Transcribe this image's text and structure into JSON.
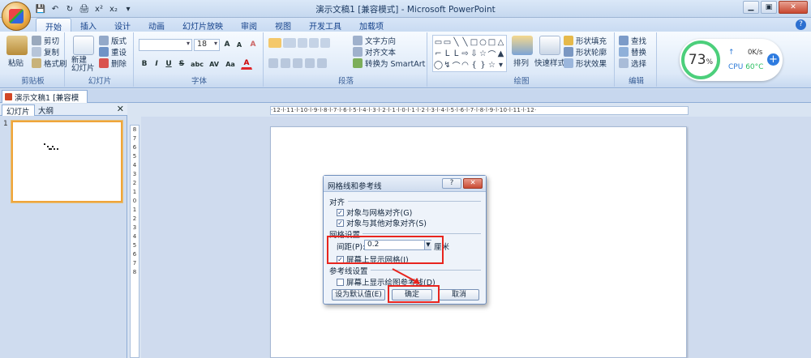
{
  "window": {
    "title": "演示文稿1 [兼容模式] - Microsoft PowerPoint",
    "controls": [
      "▁",
      "▣",
      "✕"
    ]
  },
  "qat": [
    "💾",
    "↶",
    "↻",
    "🖨",
    "x²",
    "x₂",
    "▾"
  ],
  "tabs": [
    "开始",
    "插入",
    "设计",
    "动画",
    "幻灯片放映",
    "审阅",
    "视图",
    "开发工具",
    "加载项"
  ],
  "ribbon": {
    "clipboard": {
      "label": "剪贴板",
      "paste": "粘贴",
      "cut": "剪切",
      "copy": "复制",
      "format_painter": "格式刷"
    },
    "slides": {
      "label": "幻灯片",
      "new_slide": "新建\n幻灯片",
      "layout": "版式",
      "reset": "重设",
      "delete": "删除"
    },
    "font": {
      "label": "字体",
      "font_name": "",
      "font_size": "18",
      "grow": "A",
      "shrink": "A",
      "clear": "A",
      "bold": "B",
      "italic": "I",
      "underline": "U",
      "strike": "S",
      "shadow": "abc",
      "spacing": "AV",
      "case": "Aa",
      "color": "A"
    },
    "paragraph": {
      "label": "段落",
      "text_direction": "文字方向",
      "align_text": "对齐文本",
      "smartart": "转换为 SmartArt"
    },
    "drawing": {
      "label": "绘图",
      "arrange": "排列",
      "quick_styles": "快速样式",
      "shape_fill": "形状填充",
      "shape_outline": "形状轮廓",
      "shape_effects": "形状效果"
    },
    "editing": {
      "label": "编辑",
      "find": "查找",
      "replace": "替换",
      "select": "选择"
    }
  },
  "widget": {
    "percent": "73",
    "percent_sign": "%",
    "net_speed": "0K/s",
    "cpu_label": "CPU",
    "cpu_temp": "60°C",
    "up_arrow": "↑",
    "plus": "+"
  },
  "doc_tab": "演示文稿1 [兼容模式]",
  "left_pane": {
    "tab_slides": "幻灯片",
    "tab_outline": "大纲",
    "slide_number": "1",
    "close": "✕"
  },
  "ruler": {
    "horizontal": "·12·l·11·l·10·l·9·l·8·l·7·l·6·l·5·l·4·l·3·l·2·l·1·l·0·l·1·l·2·l·3·l·4·l·5·l·6·l·7·l·8·l·9·l·10·l·11·l·12·",
    "vertical": [
      "8",
      "7",
      "6",
      "5",
      "4",
      "3",
      "2",
      "1",
      "0",
      "1",
      "2",
      "3",
      "4",
      "5",
      "6",
      "7",
      "8"
    ]
  },
  "dialog": {
    "title": "网格线和参考线",
    "help": "?",
    "close": "✕",
    "section_snap": "对齐",
    "snap_grid": "对象与网格对齐(G)",
    "snap_objects": "对象与其他对象对齐(S)",
    "section_grid": "网格设置",
    "spacing_label": "间距(P):",
    "spacing_value": "0.2",
    "spacing_unit": "厘米",
    "show_grid": "屏幕上显示网格(I)",
    "section_guides": "参考线设置",
    "show_guides": "屏幕上显示绘图参考线(D)",
    "btn_default": "设为默认值(E)",
    "btn_ok": "确定",
    "btn_cancel": "取消",
    "check_mark": "✓"
  }
}
